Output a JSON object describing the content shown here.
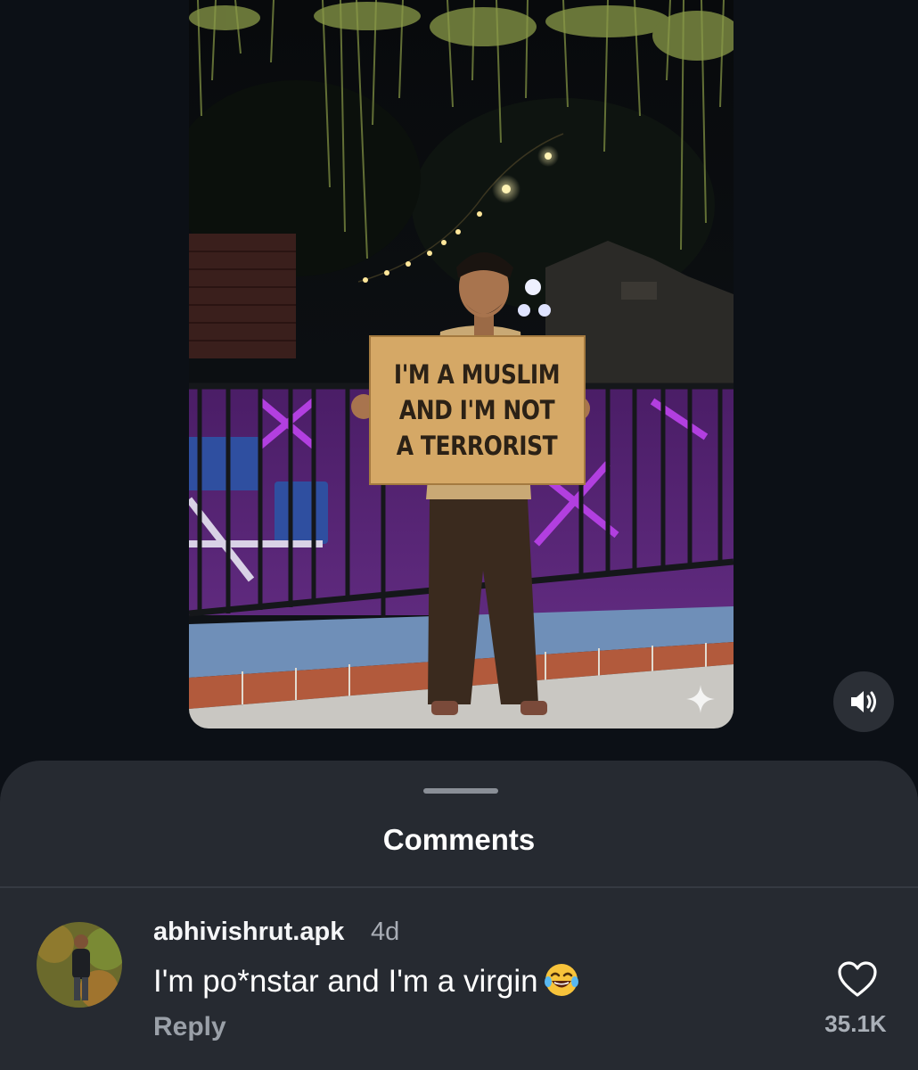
{
  "post": {
    "sign_lines": [
      "I'M A MUSLIM",
      "AND I'M NOT",
      "A TERRORIST"
    ],
    "sound_icon": "speaker-icon"
  },
  "comments_sheet": {
    "title": "Comments",
    "comment": {
      "username": "abhivishrut.apk",
      "time": "4d",
      "text": "I'm po*nstar and I'm a virgin",
      "emoji": "face-with-tears-of-joy",
      "reply_label": "Reply",
      "like_count": "35.1K"
    }
  },
  "colors": {
    "background": "#0c1016",
    "sheet": "#262a31",
    "accent_text": "#ffffff",
    "secondary_text": "#9aa0a8"
  }
}
